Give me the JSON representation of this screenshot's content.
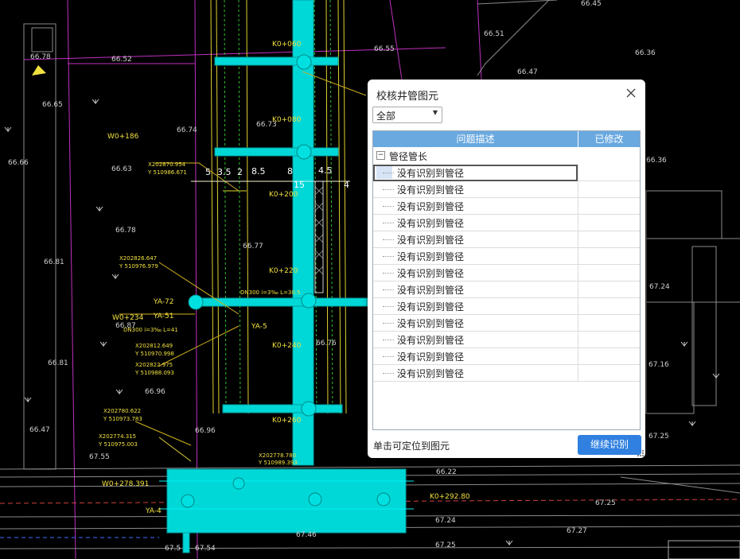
{
  "dialog": {
    "title": "校核井管图元",
    "filter_value": "全部",
    "columns": [
      "问题描述",
      "已修改"
    ],
    "group_label": "管径管长",
    "group_toggle": "−",
    "rows": [
      "没有识别到管径",
      "没有识别到管径",
      "没有识别到管径",
      "没有识别到管径",
      "没有识别到管径",
      "没有识别到管径",
      "没有识别到管径",
      "没有识别到管径",
      "没有识别到管径",
      "没有识别到管径",
      "没有识别到管径",
      "没有识别到管径",
      "没有识别到管径"
    ],
    "hint": "单击可定位到图元",
    "continue_label": "继续识别"
  },
  "cad_labels": {
    "elev": [
      "66.45",
      "66.51",
      "66.36",
      "66.78",
      "66.52",
      "66.55",
      "66.47",
      "66.65",
      "66.74",
      "66.73",
      "66.66",
      "66.63",
      "66.36",
      "66.78",
      "66.77",
      "66.81",
      "66.87",
      "66.76",
      "66.81",
      "66.96",
      "66.96",
      "66.47",
      "67.55",
      "67.24",
      "67.16",
      "67.25",
      "66.22",
      "67.25",
      "67.27",
      "67.25",
      "67.24",
      "67.54",
      "67.5",
      "67.46"
    ],
    "stations": [
      "K0+060",
      "K0+080",
      "K0+200",
      "K0+220",
      "K0+240",
      "K0+260",
      "K0+292.80",
      "W0+186",
      "W0+234",
      "W0+278.391"
    ],
    "dims": [
      "5",
      "3.5",
      "2",
      "8.5",
      "8",
      "4.5",
      "15",
      "4"
    ],
    "coords": [
      "X202870.954",
      "Y 510986.671",
      "X202826.647",
      "Y 510976.979",
      "X202812.649",
      "Y 510970.998",
      "X202822.975",
      "Y 510988.093",
      "X202774.315",
      "Y 510975.003",
      "X202780.622",
      "Y 510973.783",
      "X202778.780",
      "Y 510989.393"
    ],
    "pipes": [
      "YA-72",
      "YA-51",
      "YA-5",
      "YA-4",
      "DN300 i=3‰ L=41",
      "DN300 i=3‰ L=30.5"
    ]
  },
  "colors": {
    "road": "#00e5e5",
    "yellow": "#f0e040",
    "magenta": "#d040d0",
    "grey": "#9a9a9a",
    "accent": "#2f80e0",
    "header": "#6aa9e0"
  }
}
